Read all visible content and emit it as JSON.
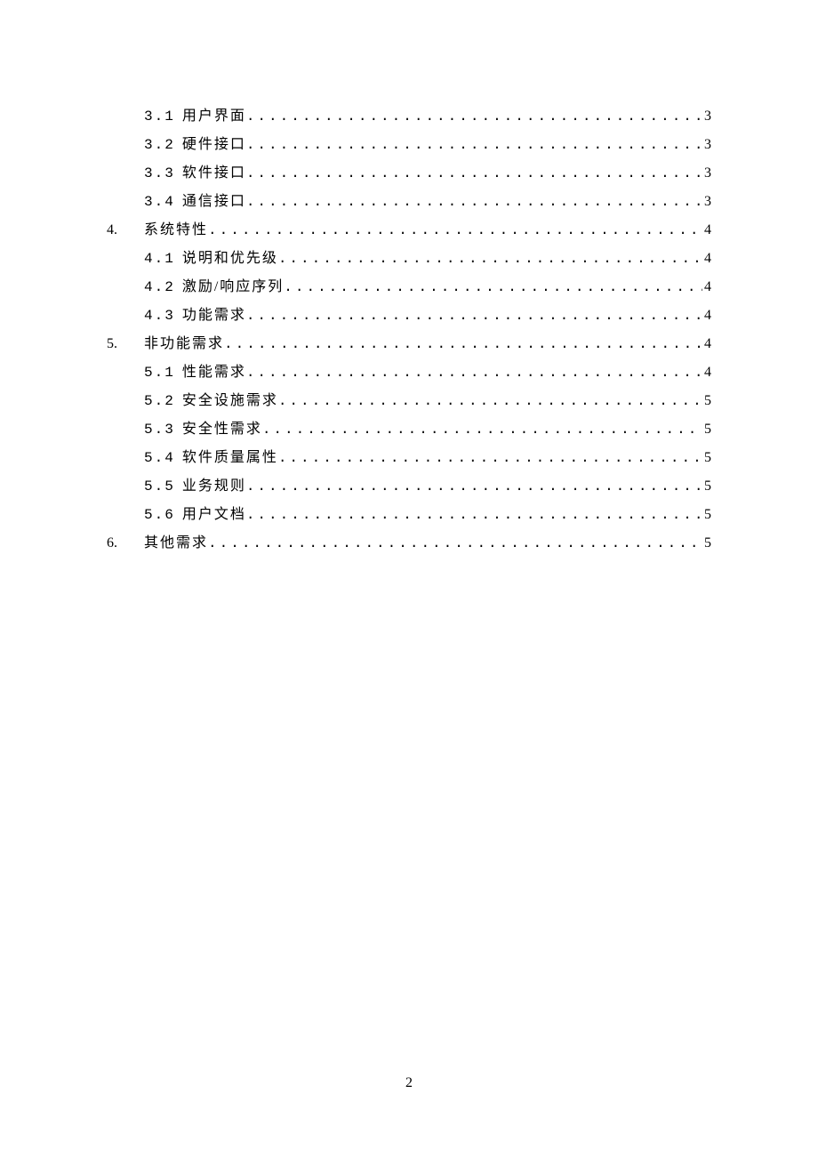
{
  "toc": [
    {
      "level": 2,
      "num": "3.1",
      "title": "用户界面",
      "page": "3"
    },
    {
      "level": 2,
      "num": "3.2",
      "title": "硬件接口",
      "page": "3"
    },
    {
      "level": 2,
      "num": "3.3",
      "title": "软件接口",
      "page": "3"
    },
    {
      "level": 2,
      "num": "3.4",
      "title": "通信接口",
      "page": "3"
    },
    {
      "level": 1,
      "num": "4.",
      "title": "系统特性",
      "page": "4"
    },
    {
      "level": 2,
      "num": "4.1",
      "title": "说明和优先级",
      "page": "4"
    },
    {
      "level": 2,
      "num": "4.2",
      "title": "激励/响应序列",
      "page": "4"
    },
    {
      "level": 2,
      "num": "4.3",
      "title": "功能需求",
      "page": "4"
    },
    {
      "level": 1,
      "num": "5.",
      "title": "非功能需求",
      "page": "4"
    },
    {
      "level": 2,
      "num": "5.1",
      "title": "性能需求",
      "page": "4"
    },
    {
      "level": 2,
      "num": "5.2",
      "title": "安全设施需求",
      "page": "5"
    },
    {
      "level": 2,
      "num": "5.3",
      "title": "安全性需求",
      "page": "5"
    },
    {
      "level": 2,
      "num": "5.4",
      "title": "软件质量属性",
      "page": "5"
    },
    {
      "level": 2,
      "num": "5.5",
      "title": "业务规则",
      "page": "5"
    },
    {
      "level": 2,
      "num": "5.6",
      "title": "用户文档",
      "page": "5"
    },
    {
      "level": 1,
      "num": "6.",
      "title": "其他需求",
      "page": "5"
    }
  ],
  "page_number": "2"
}
